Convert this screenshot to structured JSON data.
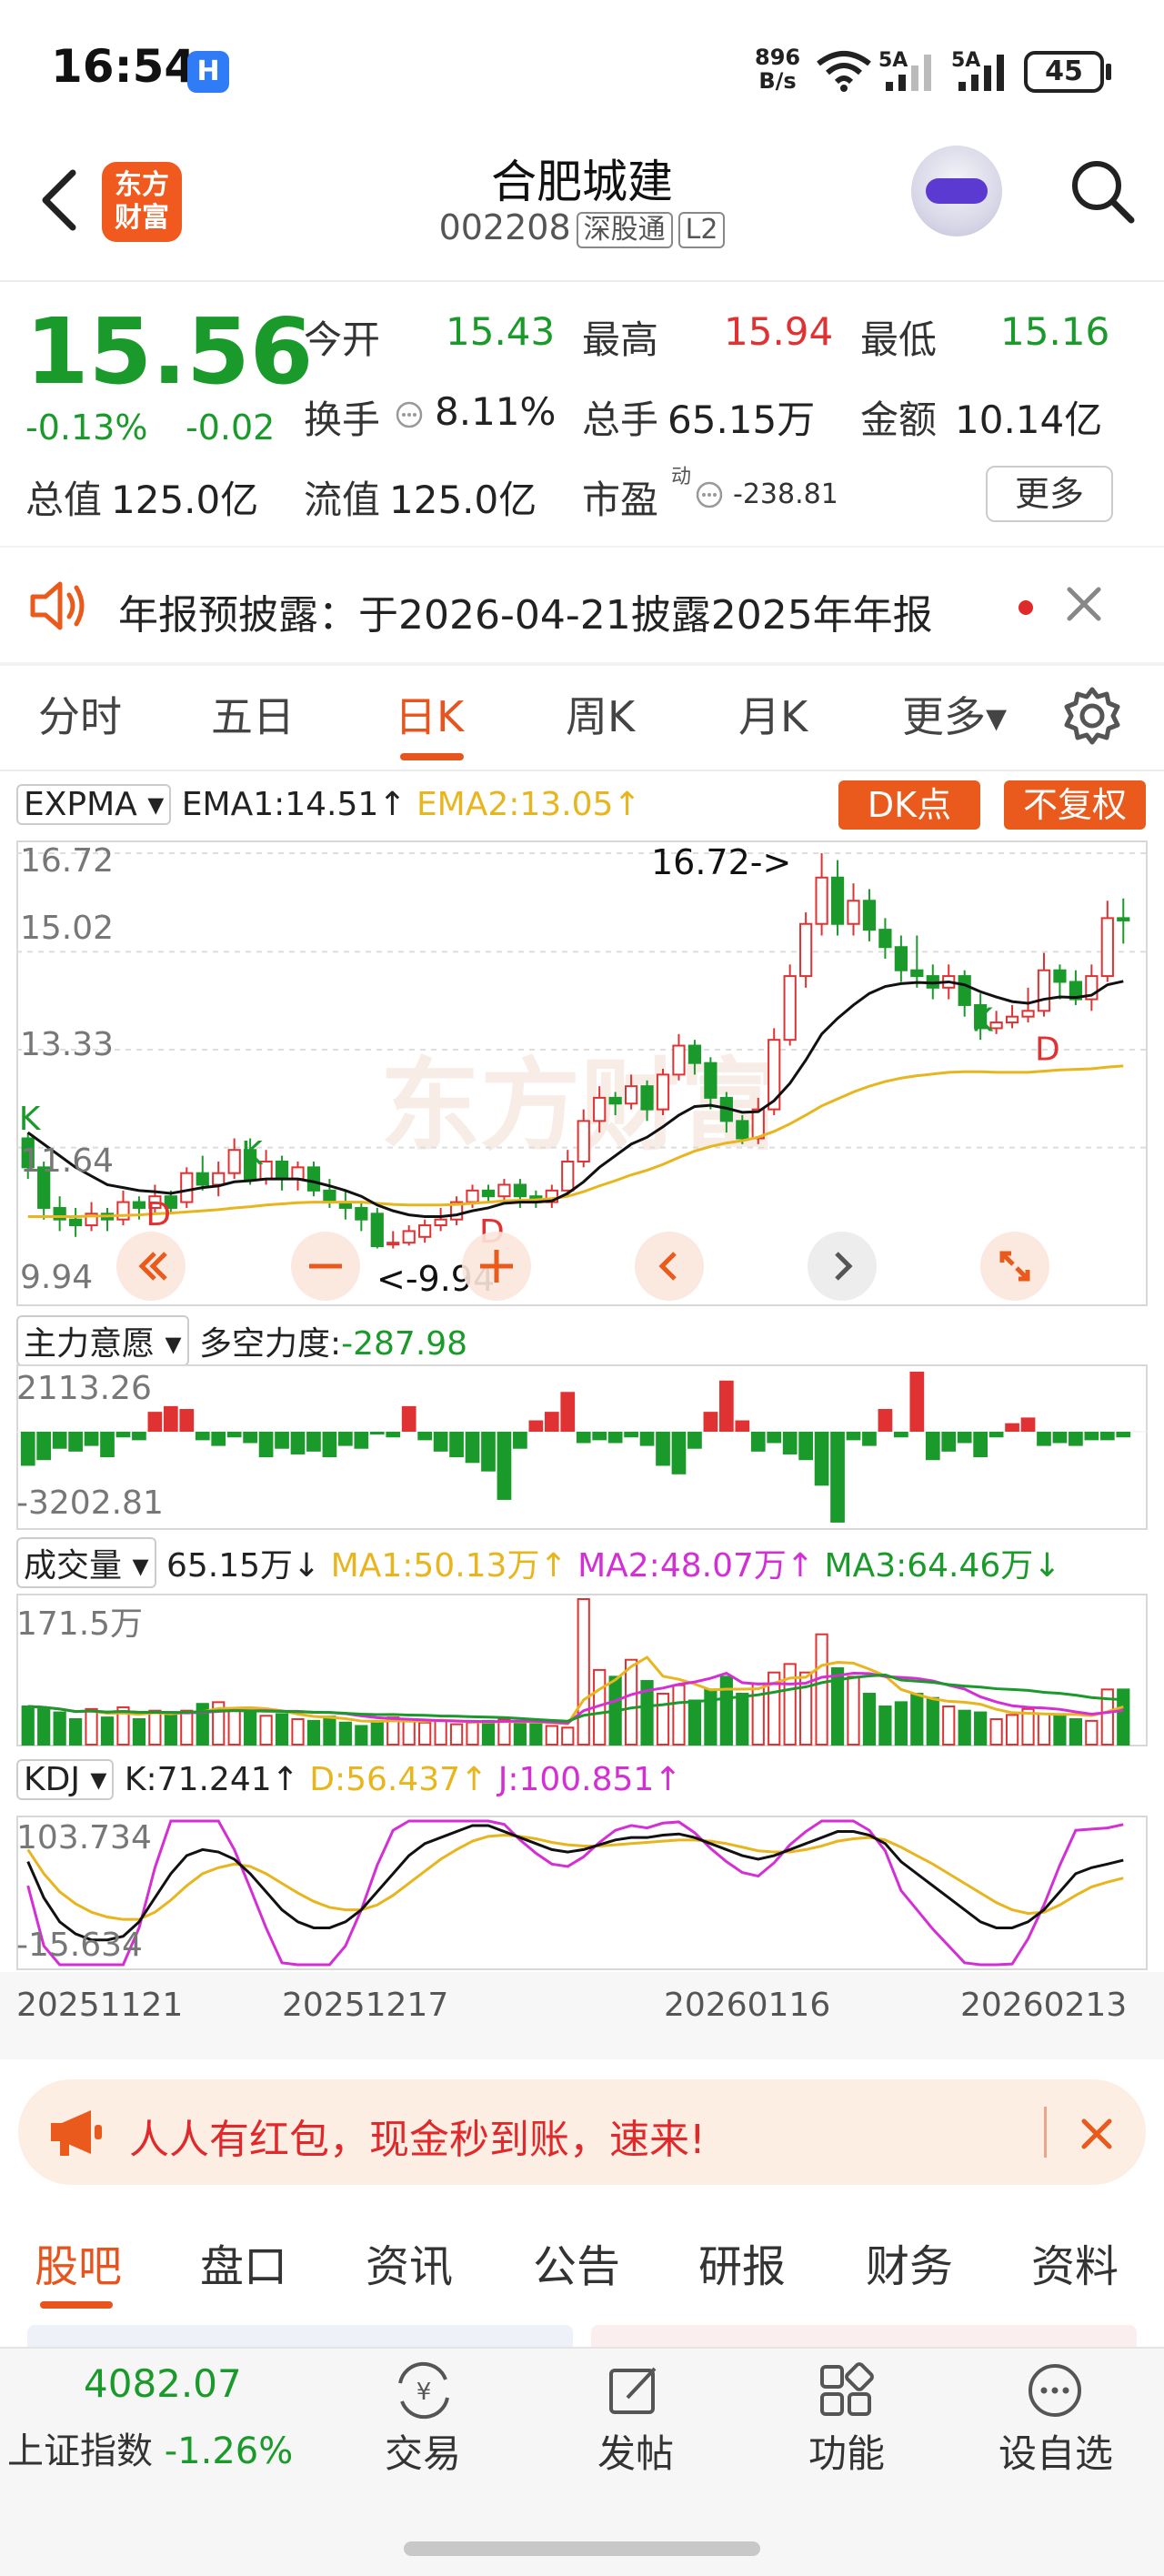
{
  "status": {
    "time": "16:54",
    "net_speed_value": "896",
    "net_speed_unit": "B/s",
    "signal1_label": "5A",
    "signal2_label": "5A",
    "battery": "45"
  },
  "header": {
    "name": "合肥城建",
    "code": "002208",
    "tag_connect": "深股通",
    "tag_level": "L2",
    "logo_line1": "东方",
    "logo_line2": "财富"
  },
  "quote": {
    "price": "15.56",
    "change_pct": "-0.13%",
    "change_val": "-0.02",
    "open_label": "今开",
    "open": "15.43",
    "high_label": "最高",
    "high": "15.94",
    "low_label": "最低",
    "low": "15.16",
    "turnover_label": "换手",
    "turnover": "8.11%",
    "volume_label": "总手",
    "volume": "65.15万",
    "amount_label": "金额",
    "amount": "10.14亿",
    "mktcap_label": "总值",
    "mktcap": "125.0亿",
    "float_label": "流值",
    "float_cap": "125.0亿",
    "pe_label": "市盈",
    "pe_sup": "动",
    "pe": "-238.81",
    "more_label": "更多"
  },
  "notice": {
    "text": "年报预披露：于2026-04-21披露2025年年报"
  },
  "period_tabs": [
    "分时",
    "五日",
    "日K",
    "周K",
    "月K",
    "更多▾"
  ],
  "kline": {
    "indicator": "EXPMA",
    "ema1": "EMA1:14.51",
    "ema2": "EMA2:13.05",
    "dk_label": "DK点",
    "adjust_label": "不复权",
    "y_labels": [
      "16.72",
      "15.02",
      "13.33",
      "11.64",
      "9.94"
    ],
    "high_marker": "16.72->",
    "low_marker": "<-9.94",
    "watermark": "东方财富"
  },
  "main_force": {
    "indicator": "主力意愿",
    "strength": "多空力度:",
    "strength_val": "-287.98",
    "top": "2113.26",
    "bottom": "-3202.81"
  },
  "volume_panel": {
    "indicator": "成交量",
    "vol": "65.15万",
    "ma1": "MA1:50.13万",
    "ma2": "MA2:48.07万",
    "ma3": "MA3:64.46万",
    "top": "171.5万"
  },
  "kdj": {
    "indicator": "KDJ",
    "k": "K:71.241",
    "d": "D:56.437",
    "j": "J:100.851",
    "top": "103.734",
    "bottom": "-15.634"
  },
  "x_dates": [
    "20251121",
    "20251217",
    "20260116",
    "20260213"
  ],
  "promo": {
    "text": "人人有红包，现金秒到账，速来!"
  },
  "bottom_tabs": [
    "股吧",
    "盘口",
    "资讯",
    "公告",
    "研报",
    "财务",
    "资料"
  ],
  "bottom_nav": {
    "index_value": "4082.07",
    "index_name": "上证指数",
    "index_change": "-1.26%",
    "items": [
      "交易",
      "发帖",
      "功能",
      "设自选"
    ]
  },
  "colors": {
    "up": "#e03232",
    "down": "#1a9a2a",
    "accent": "#e8541e"
  },
  "chart_data": {
    "type": "candlestick",
    "ylim": [
      9.94,
      16.72
    ],
    "candles": [
      [
        11.8,
        11.3,
        11.9,
        11.1
      ],
      [
        11.3,
        10.6,
        11.4,
        10.4
      ],
      [
        10.6,
        10.4,
        10.8,
        10.2
      ],
      [
        10.4,
        10.3,
        10.6,
        10.1
      ],
      [
        10.3,
        10.5,
        10.7,
        10.2
      ],
      [
        10.5,
        10.4,
        10.6,
        10.2
      ],
      [
        10.4,
        10.7,
        10.9,
        10.3
      ],
      [
        10.7,
        10.6,
        10.8,
        10.4
      ],
      [
        10.6,
        10.8,
        11.0,
        10.5
      ],
      [
        10.8,
        10.6,
        10.9,
        10.5
      ],
      [
        10.7,
        11.2,
        11.3,
        10.6
      ],
      [
        11.2,
        11.0,
        11.5,
        10.9
      ],
      [
        11.0,
        11.2,
        11.4,
        10.8
      ],
      [
        11.2,
        11.6,
        11.8,
        11.1
      ],
      [
        11.6,
        11.1,
        11.8,
        11.0
      ],
      [
        11.1,
        11.4,
        11.6,
        11.0
      ],
      [
        11.4,
        11.1,
        11.5,
        10.9
      ],
      [
        11.1,
        11.3,
        11.4,
        10.9
      ],
      [
        11.3,
        10.9,
        11.4,
        10.8
      ],
      [
        10.9,
        10.7,
        11.1,
        10.6
      ],
      [
        10.7,
        10.6,
        10.9,
        10.4
      ],
      [
        10.6,
        10.4,
        10.7,
        10.2
      ],
      [
        10.5,
        9.94,
        10.6,
        9.9
      ],
      [
        10.0,
        10.0,
        10.2,
        9.9
      ],
      [
        10.0,
        10.2,
        10.3,
        9.95
      ],
      [
        10.1,
        10.3,
        10.4,
        10.0
      ],
      [
        10.3,
        10.4,
        10.6,
        10.2
      ],
      [
        10.4,
        10.7,
        10.8,
        10.3
      ],
      [
        10.7,
        10.9,
        11.0,
        10.6
      ],
      [
        10.9,
        10.8,
        11.0,
        10.7
      ],
      [
        10.8,
        11.0,
        11.1,
        10.7
      ],
      [
        11.0,
        10.8,
        11.1,
        10.6
      ],
      [
        10.8,
        10.7,
        10.9,
        10.6
      ],
      [
        10.7,
        10.9,
        11.0,
        10.6
      ],
      [
        10.9,
        11.4,
        11.6,
        10.8
      ],
      [
        11.4,
        12.1,
        12.3,
        11.3
      ],
      [
        12.1,
        12.5,
        12.7,
        11.9
      ],
      [
        12.5,
        12.4,
        12.6,
        12.2
      ],
      [
        12.4,
        12.7,
        12.9,
        12.3
      ],
      [
        12.7,
        12.3,
        12.8,
        12.1
      ],
      [
        12.3,
        12.9,
        13.0,
        12.2
      ],
      [
        12.9,
        13.4,
        13.6,
        12.8
      ],
      [
        13.4,
        13.1,
        13.5,
        12.9
      ],
      [
        13.1,
        12.5,
        13.2,
        12.3
      ],
      [
        12.5,
        12.1,
        12.6,
        11.9
      ],
      [
        12.1,
        11.8,
        12.2,
        11.7
      ],
      [
        11.8,
        12.3,
        12.5,
        11.7
      ],
      [
        12.3,
        13.5,
        13.7,
        12.2
      ],
      [
        13.5,
        14.6,
        14.8,
        13.4
      ],
      [
        14.6,
        15.5,
        15.7,
        14.4
      ],
      [
        15.5,
        16.3,
        16.72,
        15.3
      ],
      [
        16.3,
        15.5,
        16.6,
        15.3
      ],
      [
        15.5,
        15.9,
        16.2,
        15.3
      ],
      [
        15.9,
        15.4,
        16.1,
        15.2
      ],
      [
        15.4,
        15.1,
        15.6,
        14.9
      ],
      [
        15.1,
        14.7,
        15.3,
        14.5
      ],
      [
        14.7,
        14.6,
        15.3,
        14.4
      ],
      [
        14.6,
        14.4,
        14.8,
        14.2
      ],
      [
        14.4,
        14.6,
        14.8,
        14.2
      ],
      [
        14.6,
        14.1,
        14.7,
        13.9
      ],
      [
        14.1,
        13.7,
        14.3,
        13.5
      ],
      [
        13.7,
        13.8,
        14.0,
        13.6
      ],
      [
        13.8,
        13.9,
        14.1,
        13.7
      ],
      [
        13.9,
        14.0,
        14.4,
        13.8
      ],
      [
        14.0,
        14.7,
        15.0,
        13.9
      ],
      [
        14.7,
        14.5,
        14.8,
        14.2
      ],
      [
        14.5,
        14.2,
        14.7,
        14.1
      ],
      [
        14.2,
        14.6,
        14.8,
        14.0
      ],
      [
        14.6,
        15.6,
        15.9,
        14.5
      ],
      [
        15.6,
        15.56,
        15.94,
        15.16
      ]
    ],
    "ema1": [
      11.9,
      11.7,
      11.5,
      11.3,
      11.15,
      11.0,
      10.95,
      10.9,
      10.88,
      10.85,
      10.9,
      10.95,
      10.98,
      11.05,
      11.07,
      11.1,
      11.1,
      11.1,
      11.05,
      10.98,
      10.9,
      10.8,
      10.65,
      10.55,
      10.48,
      10.45,
      10.45,
      10.48,
      10.55,
      10.6,
      10.68,
      10.7,
      10.7,
      10.72,
      10.85,
      11.05,
      11.3,
      11.5,
      11.7,
      11.82,
      12.0,
      12.2,
      12.35,
      12.37,
      12.32,
      12.25,
      12.26,
      12.45,
      12.75,
      13.15,
      13.6,
      13.87,
      14.1,
      14.3,
      14.42,
      14.47,
      14.49,
      14.48,
      14.5,
      14.45,
      14.33,
      14.24,
      14.16,
      14.13,
      14.2,
      14.24,
      14.23,
      14.27,
      14.45,
      14.51
    ],
    "ema2": [
      10.45,
      10.45,
      10.45,
      10.45,
      10.46,
      10.46,
      10.47,
      10.48,
      10.5,
      10.51,
      10.53,
      10.55,
      10.57,
      10.6,
      10.62,
      10.65,
      10.67,
      10.69,
      10.7,
      10.7,
      10.7,
      10.7,
      10.68,
      10.66,
      10.65,
      10.65,
      10.65,
      10.66,
      10.68,
      10.7,
      10.72,
      10.73,
      10.74,
      10.76,
      10.8,
      10.88,
      10.98,
      11.07,
      11.17,
      11.25,
      11.35,
      11.47,
      11.58,
      11.66,
      11.72,
      11.76,
      11.82,
      11.92,
      12.05,
      12.2,
      12.36,
      12.48,
      12.6,
      12.7,
      12.78,
      12.84,
      12.88,
      12.91,
      12.94,
      12.95,
      12.95,
      12.94,
      12.94,
      12.94,
      12.96,
      12.98,
      12.99,
      13.0,
      13.03,
      13.05
    ],
    "main_force": [
      -1200,
      -1000,
      -600,
      -700,
      -500,
      -900,
      -200,
      -300,
      700,
      900,
      800,
      -300,
      -500,
      -200,
      -400,
      -900,
      -600,
      -800,
      -700,
      -900,
      -500,
      -600,
      -100,
      -200,
      900,
      -300,
      -700,
      -900,
      -1100,
      -1400,
      -2400,
      -600,
      400,
      700,
      1400,
      -400,
      -300,
      -400,
      -200,
      -500,
      -1200,
      -1500,
      -600,
      700,
      1800,
      400,
      -700,
      -400,
      -800,
      -1000,
      -1900,
      -3200,
      -300,
      -500,
      800,
      -200,
      2113,
      -1000,
      -700,
      -400,
      -900,
      -200,
      300,
      500,
      -500,
      -400,
      -500,
      -300,
      -300,
      -200
    ],
    "volume": [
      45,
      43,
      38,
      30,
      42,
      32,
      44,
      30,
      40,
      35,
      40,
      48,
      50,
      42,
      38,
      34,
      36,
      30,
      28,
      33,
      26,
      22,
      28,
      32,
      30,
      26,
      28,
      24,
      26,
      28,
      30,
      26,
      24,
      22,
      20,
      171.5,
      88,
      80,
      100,
      75,
      60,
      70,
      52,
      65,
      80,
      60,
      72,
      85,
      95,
      85,
      130,
      90,
      80,
      60,
      45,
      50,
      60,
      55,
      45,
      40,
      38,
      30,
      35,
      42,
      36,
      35,
      30,
      28,
      65,
      65
    ],
    "kdj_k": [
      70,
      40,
      20,
      10,
      5,
      5,
      8,
      20,
      40,
      60,
      75,
      80,
      78,
      72,
      60,
      45,
      30,
      20,
      15,
      15,
      20,
      30,
      45,
      60,
      75,
      85,
      90,
      95,
      100,
      100,
      95,
      90,
      85,
      80,
      78,
      80,
      84,
      88,
      90,
      90,
      92,
      93,
      90,
      85,
      80,
      75,
      72,
      75,
      80,
      85,
      90,
      95,
      95,
      92,
      85,
      70,
      60,
      50,
      40,
      30,
      20,
      15,
      15,
      20,
      30,
      45,
      60,
      65,
      68,
      71.2
    ],
    "kdj_d": [
      80,
      60,
      45,
      35,
      28,
      24,
      22,
      22,
      28,
      38,
      50,
      60,
      65,
      68,
      66,
      60,
      52,
      44,
      37,
      32,
      30,
      30,
      34,
      42,
      52,
      62,
      72,
      80,
      87,
      91,
      92,
      91,
      89,
      86,
      84,
      83,
      83,
      84,
      85,
      86,
      87,
      88,
      88,
      87,
      85,
      82,
      79,
      78,
      78,
      80,
      83,
      87,
      89,
      90,
      88,
      82,
      75,
      68,
      60,
      52,
      44,
      36,
      30,
      27,
      28,
      34,
      42,
      49,
      53,
      56.4
    ],
    "kdj_j": [
      50,
      0,
      -30,
      -40,
      -45,
      -40,
      -20,
      15,
      65,
      105,
      125,
      120,
      104,
      80,
      48,
      15,
      -14,
      -28,
      -29,
      -19,
      0,
      30,
      67,
      96,
      121,
      131,
      126,
      125,
      126,
      118,
      101,
      88,
      77,
      68,
      66,
      74,
      86,
      96,
      100,
      98,
      102,
      103,
      94,
      81,
      70,
      61,
      58,
      69,
      84,
      95,
      104,
      111,
      107,
      96,
      79,
      46,
      30,
      14,
      0,
      -14,
      -28,
      -27,
      -15,
      6,
      34,
      67,
      96,
      97,
      98,
      100.85
    ]
  }
}
